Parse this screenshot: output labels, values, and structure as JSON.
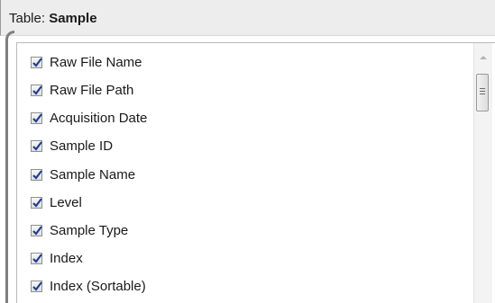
{
  "header": {
    "prefix": "Table: ",
    "table_name": "Sample"
  },
  "list": {
    "items": [
      {
        "label": "Raw File Name",
        "checked": true
      },
      {
        "label": "Raw File Path",
        "checked": true
      },
      {
        "label": "Acquisition Date",
        "checked": true
      },
      {
        "label": "Sample ID",
        "checked": true
      },
      {
        "label": "Sample Name",
        "checked": true
      },
      {
        "label": "Level",
        "checked": true
      },
      {
        "label": "Sample Type",
        "checked": true
      },
      {
        "label": "Index",
        "checked": true
      },
      {
        "label": "Index (Sortable)",
        "checked": true
      }
    ]
  },
  "icons": {
    "checkmark": "checkmark-icon",
    "scroll_up": "scroll-up-arrow-icon",
    "scroll_grip": "scroll-grip-icon"
  },
  "colors": {
    "check": "#1f3f8f",
    "header_bg": "#ededed",
    "border": "#b9b9b9"
  }
}
